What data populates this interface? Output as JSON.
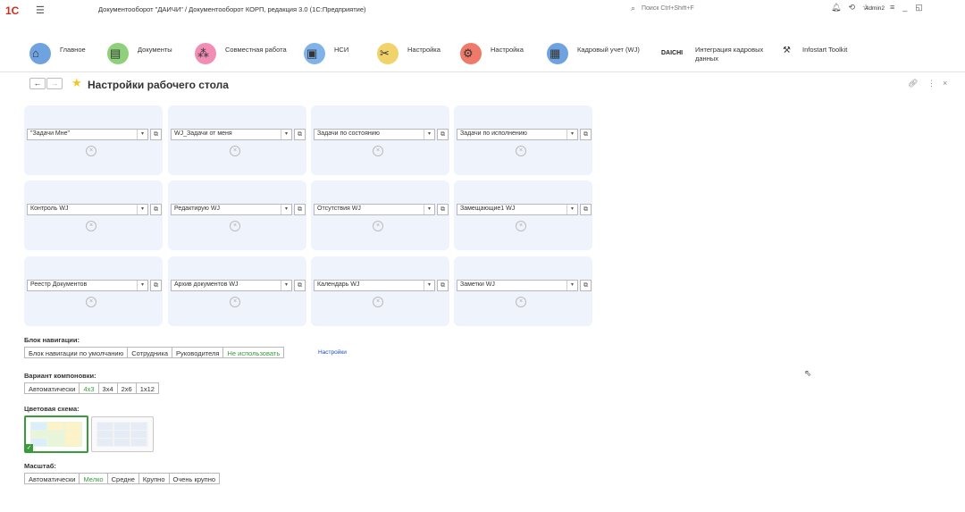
{
  "titlebar": {
    "logo": "1C",
    "window_title": "Документооборот \"ДАИЧИ\" / Документооборот КОРП, редакция 3.0  (1С:Предприятие)",
    "search_placeholder": "Поиск Ctrl+Shift+F",
    "user": "Admin2"
  },
  "sections": [
    {
      "label": "Главное",
      "icon": "home-icon"
    },
    {
      "label": "Документы",
      "icon": "documents-icon"
    },
    {
      "label": "Совместная работа",
      "icon": "collaboration-icon"
    },
    {
      "label": "НСИ",
      "icon": "nsi-icon"
    },
    {
      "label": "Настройка",
      "icon": "tools-icon"
    },
    {
      "label": "Настройка",
      "icon": "settings-gear-icon"
    },
    {
      "label": "Кадровый учет (WJ)",
      "icon": "hr-icon"
    },
    {
      "label": "Интеграция кадровых данных",
      "icon": "daichi-icon",
      "logo_text": "DAICHI"
    },
    {
      "label": "Infostart Toolkit",
      "icon": "toolkit-icon"
    }
  ],
  "page": {
    "title": "Настройки рабочего стола"
  },
  "widgets": [
    "\"Задачи Мне\"",
    "WJ_Задачи от меня",
    "Задачи по состоянию",
    "Задачи по исполнению",
    "Контроль WJ",
    "Редактирую WJ",
    "Отсутствия WJ",
    "Замещающие1 WJ",
    "Реестр Документов",
    "Архив документов WJ",
    "Календарь WJ",
    "Заметки WJ"
  ],
  "nav_block": {
    "label": "Блок навигации:",
    "options": [
      "Блок навигации по умолчанию",
      "Сотрудника",
      "Руководителя",
      "Не использовать"
    ],
    "selected": "Не использовать",
    "settings_link": "Настройки"
  },
  "layout_variant": {
    "label": "Вариант компоновки:",
    "options": [
      "Автоматически",
      "4x3",
      "3x4",
      "2x6",
      "1x12"
    ],
    "selected": "4x3"
  },
  "color_scheme": {
    "label": "Цветовая схема:",
    "selected_index": 0
  },
  "scale": {
    "label": "Масштаб:",
    "options": [
      "Автоматически",
      "Мелко",
      "Средне",
      "Крупно",
      "Очень крупно"
    ],
    "selected": "Мелко"
  },
  "colors": {
    "accent_green": "#3a9b3a",
    "widget_bg": "#eef3fc",
    "link": "#1b4fb5",
    "logo_red": "#d42b1f",
    "star": "#f3c623"
  }
}
